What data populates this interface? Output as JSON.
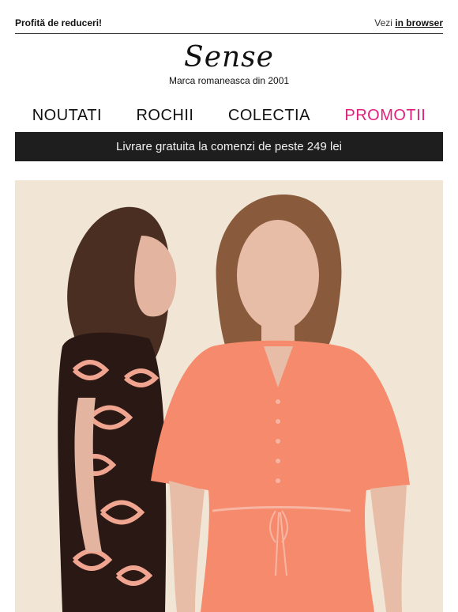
{
  "topbar": {
    "promo_text": "Profită de reduceri!",
    "view_prefix": "Vezi",
    "view_link": "in browser"
  },
  "brand": {
    "logo_text": "Sense",
    "tagline": "Marca romaneasca din 2001"
  },
  "nav": {
    "items": [
      {
        "label": "NOUTATI"
      },
      {
        "label": "ROCHII"
      },
      {
        "label": "COLECTIA"
      },
      {
        "label": "PROMOTII"
      }
    ],
    "promo_color": "#e01e7c"
  },
  "banner": {
    "text": "Livrare gratuita la comenzi de peste 249 lei"
  },
  "colors": {
    "hero_background": "#f1e6d6",
    "coral_dress": "#f58a6c",
    "banner_background": "#1e1e1e"
  }
}
